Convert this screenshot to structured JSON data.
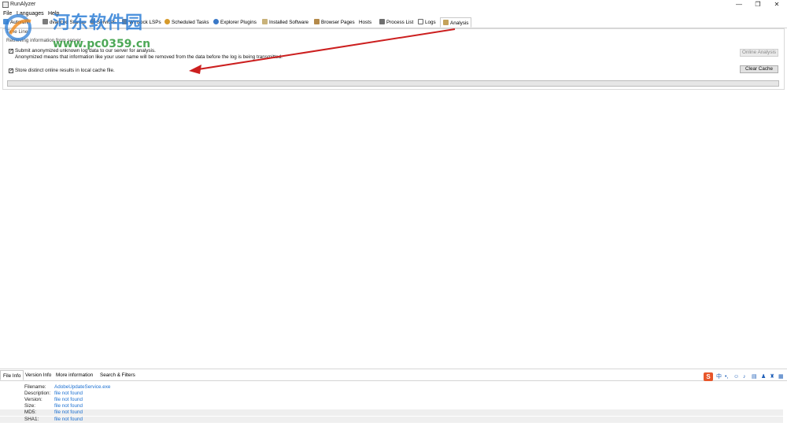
{
  "window": {
    "title": "RunAlyzer",
    "minimize_glyph": "—",
    "restore_glyph": "❐",
    "close_glyph": "✕"
  },
  "menu": [
    "File",
    "Languages",
    "Help"
  ],
  "tabs": [
    {
      "label": "Autorun",
      "icon": "autorun-icon"
    },
    {
      "label": "dvanced Startup",
      "icon": "startup-icon"
    },
    {
      "label": "Services",
      "icon": "services-icon"
    },
    {
      "label": "Winsock LSPs",
      "icon": "winsock-icon"
    },
    {
      "label": "Scheduled Tasks",
      "icon": "scheduled-tasks-icon"
    },
    {
      "label": "Explorer Plugins",
      "icon": "explorer-plugins-icon"
    },
    {
      "label": "Installed Software",
      "icon": "installed-software-icon"
    },
    {
      "label": "Browser Pages",
      "icon": "browser-pages-icon"
    },
    {
      "label": "Hosts",
      "icon": ""
    },
    {
      "label": "Process List",
      "icon": "process-list-icon"
    },
    {
      "label": "Logs",
      "icon": "logs-icon"
    },
    {
      "label": "Analysis",
      "icon": "analysis-icon"
    }
  ],
  "analysis": {
    "status": "Retrieving information from server...",
    "status_prefix": "Time Line",
    "submit_checkbox_label": "Submit anonymized unknown log data to our server for analysis.",
    "submit_note": "Anonymized means that information like your user name will be removed from the data before the log is being transmitted.",
    "submit_checked": true,
    "cache_checkbox_label": "Store distinct online results in local cache file.",
    "cache_checked": true,
    "online_analysis_button": "Online Analysis",
    "clear_cache_button": "Clear Cache",
    "progress_fraction": 0.0
  },
  "bottom_tabs": [
    "File Info",
    "Version Info",
    "More information",
    "Search & Filters"
  ],
  "file_info": [
    {
      "key": "Filename:",
      "value": "AdobeUpdateService.exe"
    },
    {
      "key": "Description:",
      "value": "file not found"
    },
    {
      "key": "Version:",
      "value": "file not found"
    },
    {
      "key": "Size:",
      "value": "file not found"
    },
    {
      "key": "MD5:",
      "value": "file not found"
    },
    {
      "key": "SHA1:",
      "value": "file not found"
    }
  ],
  "watermark": {
    "cn_text": "河东软件园",
    "url_text": "www.pc0359.cn"
  },
  "tray": {
    "ime_logo": "S",
    "ime_lang": "中",
    "punct": "•,",
    "icons": [
      "smile-icon",
      "microphone-icon",
      "keyboard-icon",
      "user-icon",
      "shirt-icon",
      "grid-icon"
    ]
  },
  "colors": {
    "arrow": "#cc1f1f",
    "link": "#1a6fd1",
    "watermark": "#2f7fd6"
  }
}
